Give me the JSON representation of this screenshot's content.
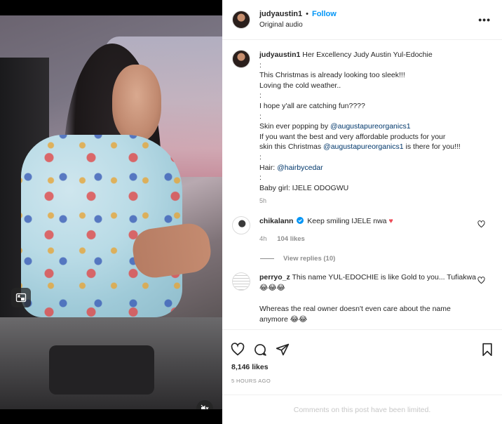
{
  "header": {
    "username": "judyaustin1",
    "separator": "•",
    "follow_label": "Follow",
    "subtitle": "Original audio",
    "more_label": "•••"
  },
  "caption": {
    "username": "judyaustin1",
    "lines": [
      "Her Excellency Judy Austin Yul-Edochie",
      ":",
      "This Christmas is already looking too sleek!!!",
      "Loving the cold weather..",
      ":",
      "I hope y'all are catching fun????",
      ":",
      "Skin ever popping by ",
      "If you want the best and very affordable products for your",
      "skin this Christmas ",
      ":",
      "Hair: ",
      ":",
      "Baby girl: IJELE ODOGWU"
    ],
    "mention_skin": "@augustapureorganics1",
    "mention_skin2": "@augustapureorganics1",
    "skin2_suffix": " is there for you!!!",
    "mention_hair": "@hairbycedar",
    "time": "5h"
  },
  "comments": [
    {
      "username": "chikalann",
      "verified": true,
      "text": "Keep smiling IJELE nwa",
      "emoji": "♥",
      "time": "4h",
      "likes": "104 likes"
    },
    {
      "username": "perryo_z",
      "text": "This name YUL-EDOCHIE is like Gold to you... Tufiakwa 😂😂😂",
      "text2": "Whereas the real owner doesn't even care about the name anymore 😂😂"
    }
  ],
  "view_replies": "View replies (10)",
  "likes_count": "8,146 likes",
  "time_ago": "5 HOURS AGO",
  "limited_notice": "Comments on this post have been limited.",
  "colors": {
    "accent": "#0095f6",
    "verified": "#0095f6",
    "heart": "#ed4956"
  }
}
